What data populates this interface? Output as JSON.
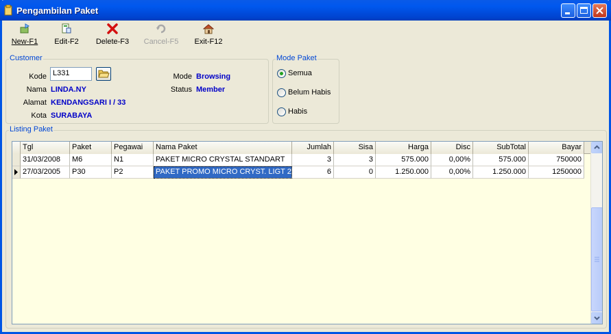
{
  "window": {
    "title": "Pengambilan Paket"
  },
  "toolbar": [
    {
      "label": "New-F1",
      "icon": "new-icon",
      "enabled": true
    },
    {
      "label": "Edit-F2",
      "icon": "edit-icon",
      "enabled": true
    },
    {
      "label": "Delete-F3",
      "icon": "delete-icon",
      "enabled": true
    },
    {
      "label": "Cancel-F5",
      "icon": "cancel-icon",
      "enabled": false
    },
    {
      "label": "Exit-F12",
      "icon": "exit-icon",
      "enabled": true
    }
  ],
  "customer": {
    "legend": "Customer",
    "kode_label": "Kode",
    "kode_value": "L331",
    "nama_label": "Nama",
    "nama_value": "LINDA.NY",
    "alamat_label": "Alamat",
    "alamat_value": "KENDANGSARI I / 33",
    "kota_label": "Kota",
    "kota_value": "SURABAYA",
    "mode_label": "Mode",
    "mode_value": "Browsing",
    "status_label": "Status",
    "status_value": "Member"
  },
  "mode_paket": {
    "legend": "Mode Paket",
    "options": [
      "Semua",
      "Belum Habis",
      "Habis"
    ],
    "selected": "Semua"
  },
  "listing": {
    "legend": "Listing Paket",
    "columns": [
      "Tgl",
      "Paket",
      "Pegawai",
      "Nama Paket",
      "Jumlah",
      "Sisa",
      "Harga",
      "Disc",
      "SubTotal",
      "Bayar"
    ],
    "rows": [
      [
        "31/03/2008",
        "M6",
        "N1",
        "PAKET MICRO CRYSTAL STANDART",
        "3",
        "3",
        "575.000",
        "0,00%",
        "575.000",
        "750000"
      ],
      [
        "27/03/2005",
        "P30",
        "P2",
        "PAKET PROMO MICRO CRYST. LIGT 2",
        "6",
        "0",
        "1.250.000",
        "0,00%",
        "1.250.000",
        "1250000"
      ]
    ]
  },
  "colors": {
    "titlebar": "#0058ee",
    "accent_text": "#0000c8",
    "legend": "#0046d5",
    "grid_bg": "#ffffe3"
  }
}
